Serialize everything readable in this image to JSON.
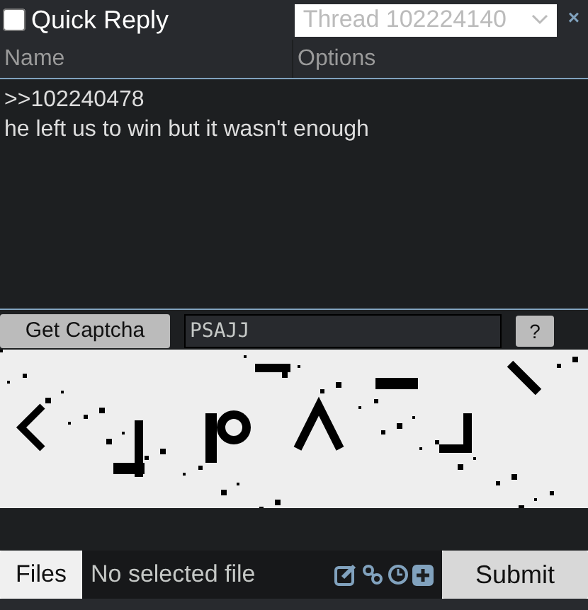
{
  "header": {
    "checked": false,
    "title": "Quick Reply",
    "thread": "Thread 102224140",
    "close": "×"
  },
  "fields": {
    "name_placeholder": "Name",
    "options_placeholder": "Options",
    "comment": ">>102240478\nhe left us to win but it wasn't enough"
  },
  "captcha": {
    "button": "Get Captcha",
    "value": "PSAJJ",
    "help": "?"
  },
  "footer": {
    "files": "Files",
    "file_status": "No selected file",
    "submit": "Submit"
  }
}
